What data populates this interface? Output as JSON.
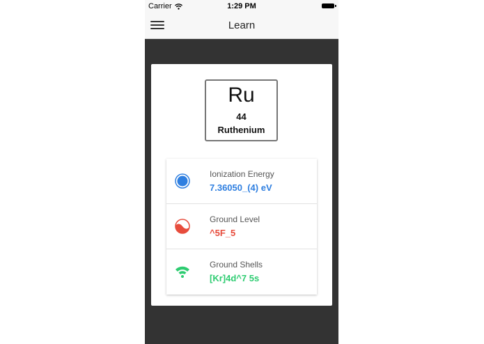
{
  "status": {
    "carrier": "Carrier",
    "time": "1:29 PM"
  },
  "appbar": {
    "title": "Learn"
  },
  "element": {
    "symbol": "Ru",
    "number": "44",
    "name": "Ruthenium"
  },
  "properties": [
    {
      "label": "Ionization Energy",
      "value": "7.36050_(4) eV",
      "color": "#2f7fe0",
      "icon": "circle-icon"
    },
    {
      "label": "Ground Level",
      "value": "^5F_5",
      "color": "#e74c3c",
      "icon": "wave-circle-icon"
    },
    {
      "label": "Ground Shells",
      "value": "[Kr]4d^7 5s",
      "color": "#2ecc71",
      "icon": "wifi-signal-icon"
    }
  ]
}
